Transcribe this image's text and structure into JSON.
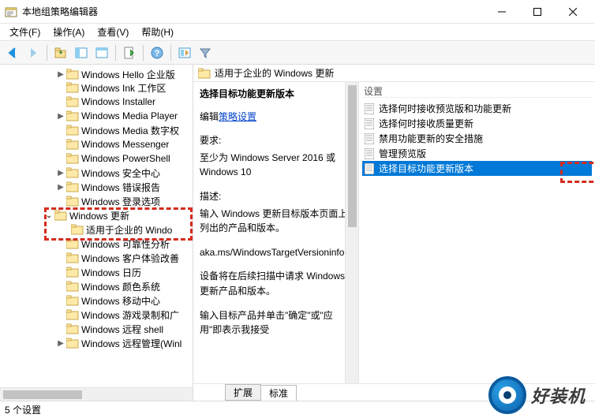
{
  "window": {
    "title": "本地组策略编辑器"
  },
  "menu": {
    "file": "文件(F)",
    "action": "操作(A)",
    "view": "查看(V)",
    "help": "帮助(H)"
  },
  "tree": [
    {
      "label": "Windows Hello 企业版",
      "depth": 1
    },
    {
      "label": "Windows Ink 工作区",
      "depth": 1
    },
    {
      "label": "Windows Installer",
      "depth": 1
    },
    {
      "label": "Windows Media Player",
      "depth": 1
    },
    {
      "label": "Windows Media 数字权",
      "depth": 1
    },
    {
      "label": "Windows Messenger",
      "depth": 1
    },
    {
      "label": "Windows PowerShell",
      "depth": 1
    },
    {
      "label": "Windows 安全中心",
      "depth": 1
    },
    {
      "label": "Windows 错误报告",
      "depth": 1
    },
    {
      "label": "Windows 登录选项",
      "depth": 1
    },
    {
      "label": "Windows 更新",
      "depth": 0,
      "expanded": true
    },
    {
      "label": "适用于企业的 Windo",
      "depth": 2
    },
    {
      "label": "Windows 可靠性分析",
      "depth": 1
    },
    {
      "label": "Windows 客户体验改善",
      "depth": 1
    },
    {
      "label": "Windows 日历",
      "depth": 1
    },
    {
      "label": "Windows 颜色系统",
      "depth": 1
    },
    {
      "label": "Windows 移动中心",
      "depth": 1
    },
    {
      "label": "Windows 游戏录制和广",
      "depth": 1
    },
    {
      "label": "Windows 远程 shell",
      "depth": 1
    },
    {
      "label": "Windows 远程管理(Winl",
      "depth": 1
    }
  ],
  "right": {
    "header": "适用于企业的 Windows 更新",
    "detail": {
      "heading": "选择目标功能更新版本",
      "edit_prefix": "编辑",
      "edit_link": "策略设置",
      "req_label": "要求:",
      "req_text": "至少为 Windows Server 2016 或 Windows 10",
      "desc_label": "描述:",
      "desc_1": "输入 Windows 更新目标版本页面上列出的产品和版本。",
      "desc_link": "aka.ms/WindowsTargetVersioninfo",
      "desc_2": "设备将在后续扫描中请求 Windows 更新产品和版本。",
      "desc_3": "输入目标产品并单击\"确定\"或\"应用\"即表示我接受"
    },
    "settings_header": "设置",
    "settings": [
      {
        "label": "选择何时接收预览版和功能更新"
      },
      {
        "label": "选择何时接收质量更新"
      },
      {
        "label": "禁用功能更新的安全措施"
      },
      {
        "label": "管理预览版"
      },
      {
        "label": "选择目标功能更新版本",
        "selected": true
      }
    ],
    "tabs": {
      "extended": "扩展",
      "standard": "标准"
    }
  },
  "statusbar": "5 个设置",
  "logo": "好装机"
}
